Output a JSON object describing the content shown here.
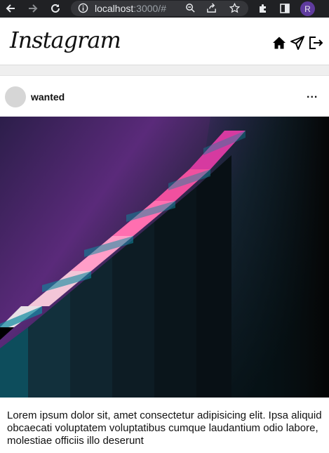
{
  "browser": {
    "url_host": "localhost",
    "url_path": ":3000/#",
    "profile_initial": "R"
  },
  "app": {
    "logo": "Instagram"
  },
  "post": {
    "username": "wanted",
    "more_label": "...",
    "caption": "Lorem ipsum dolor sit, amet consectetur adipisicing elit. Ipsa aliquid obcaecati voluptatem voluptatibus cumque laudantium odio labore, molestiae officiis illo deserunt"
  },
  "colors": {
    "chrome_bg": "#202124",
    "omnibox_bg": "#35363a",
    "profile": "#5f3b9e",
    "stair_pink": "#ff6fb0",
    "stair_magenta": "#d63aa0"
  },
  "icons": [
    "back-icon",
    "forward-icon",
    "reload-icon",
    "info-icon",
    "zoom-icon",
    "share-icon",
    "star-icon",
    "extensions-icon",
    "sidepanel-icon",
    "home-icon",
    "send-icon",
    "logout-icon"
  ]
}
